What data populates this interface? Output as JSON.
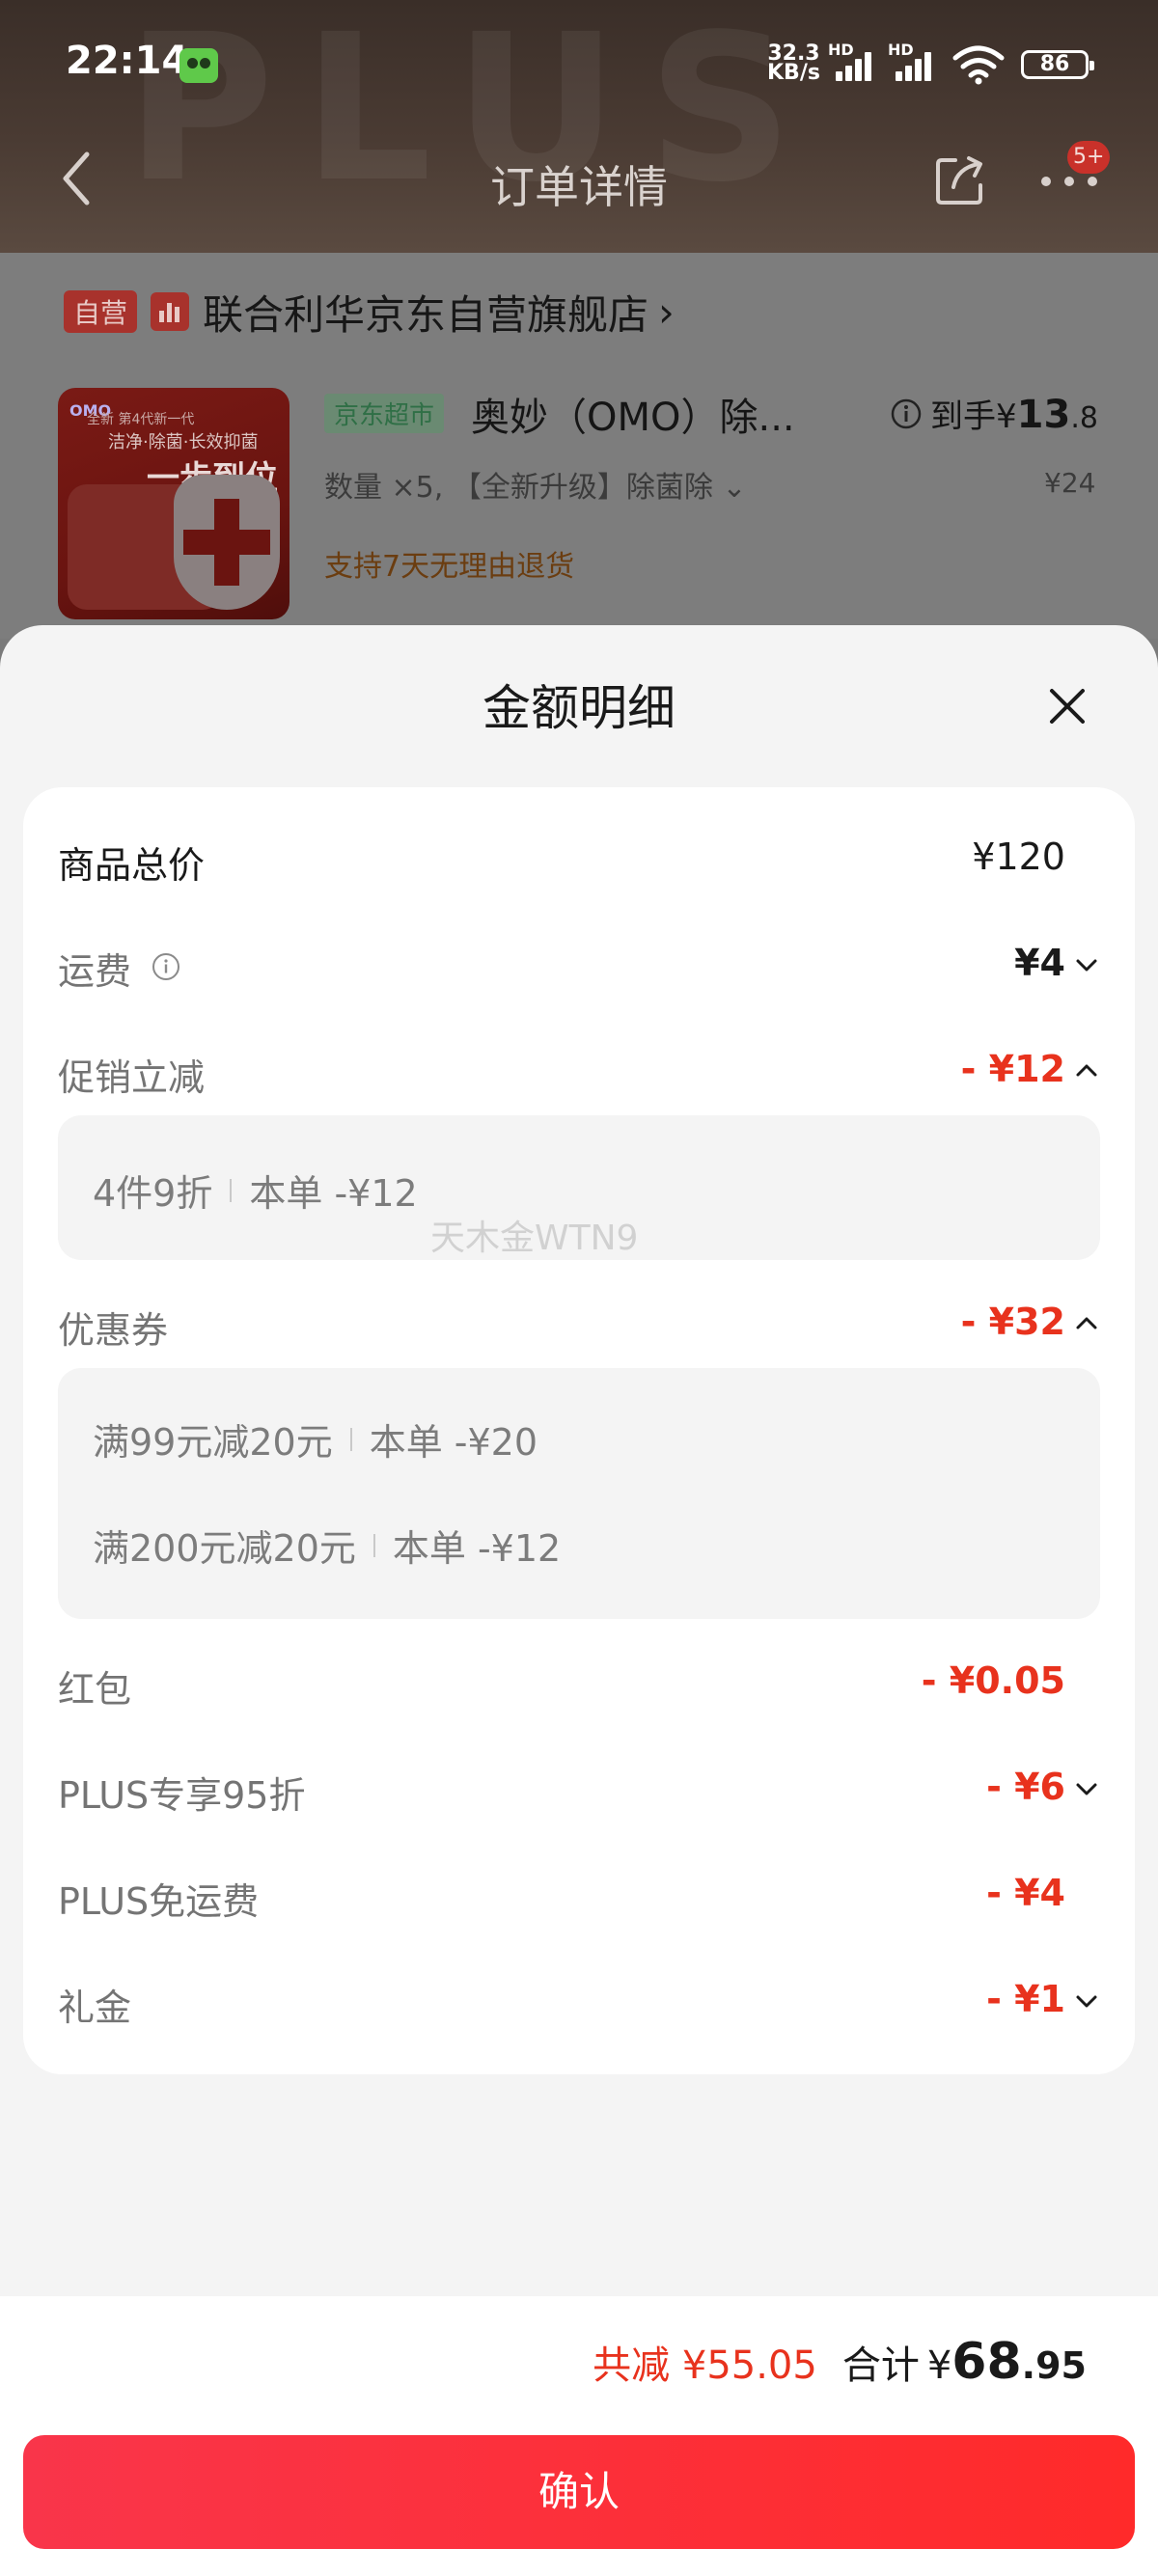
{
  "status_bar": {
    "time": "22:14",
    "net_speed_value": "32.3",
    "net_speed_unit": "KB/s",
    "hd1": "HD",
    "hd2": "HD",
    "battery": "86"
  },
  "header": {
    "title": "订单详情",
    "msg_badge": "5+",
    "watermark": "PLUS"
  },
  "order": {
    "self_tag": "自营",
    "store_name": "联合利华京东自营旗舰店",
    "store_arrow": "›",
    "product": {
      "image_text_1": "全新 第4代新一代",
      "image_text_2": "洁净·除菌·长效抑菌",
      "image_text_3": "一步到位",
      "image_brand": "OMO",
      "channel_tag": "京东超市",
      "title": "奥妙（OMO）除...",
      "price_label": "到手¥",
      "price_int": "13",
      "price_dec": ".8",
      "spec": "数量 ×5, 【全新升级】除菌除 ⌄",
      "unit_price": "¥24",
      "policy": "支持7天无理由退货"
    }
  },
  "sheet": {
    "title": "金额明细",
    "rows": [
      {
        "label": "商品总价",
        "value": "¥120"
      },
      {
        "label": "运费",
        "value": "¥4"
      },
      {
        "label": "促销立减",
        "value": "- ¥12"
      },
      {
        "label": "优惠券",
        "value": "- ¥32"
      },
      {
        "label": "红包",
        "value": "- ¥0.05"
      },
      {
        "label": "PLUS专享95折",
        "value": "- ¥6"
      },
      {
        "label": "PLUS免运费",
        "value": "- ¥4"
      },
      {
        "label": "礼金",
        "value": "- ¥1"
      }
    ],
    "promo_details": [
      {
        "name": "4件9折",
        "amount": "本单 -¥12"
      }
    ],
    "coupon_details": [
      {
        "name": "满99元减20元",
        "amount": "本单 -¥20"
      },
      {
        "name": "满200元减20元",
        "amount": "本单 -¥12"
      }
    ],
    "watermark": "天木金WTN9"
  },
  "footer": {
    "saved": "共减 ¥55.05",
    "total_label": "合计",
    "total_yen": "¥",
    "total_int": "68",
    "total_dec": ".95",
    "confirm": "确认"
  },
  "colors": {
    "accent_red": "#e8321d",
    "button_start": "#f9354a",
    "button_end": "#ff2a2a"
  }
}
